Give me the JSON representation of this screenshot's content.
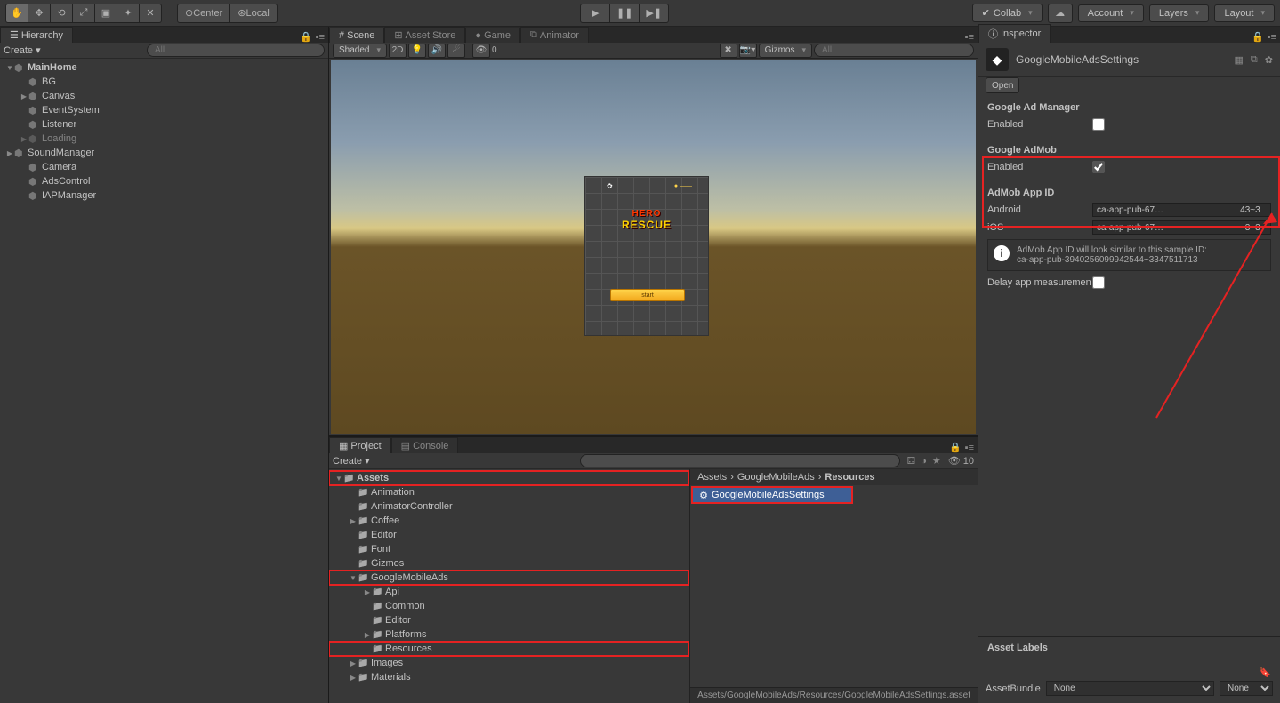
{
  "toolbar": {
    "center_label": "Center",
    "local_label": "Local",
    "collab_label": "Collab",
    "account_label": "Account",
    "layers_label": "Layers",
    "layout_label": "Layout"
  },
  "hierarchy": {
    "tab": "Hierarchy",
    "create_label": "Create",
    "search_placeholder": "All",
    "items": [
      {
        "label": "MainHome",
        "depth": 0,
        "arrow": "▼",
        "bold": true,
        "icon": "unity"
      },
      {
        "label": "BG",
        "depth": 1
      },
      {
        "label": "Canvas",
        "depth": 1,
        "arrow": "▶"
      },
      {
        "label": "EventSystem",
        "depth": 1
      },
      {
        "label": "Listener",
        "depth": 1
      },
      {
        "label": "Loading",
        "depth": 1,
        "arrow": "▶",
        "dim": true
      },
      {
        "label": "SoundManager",
        "depth": 0,
        "arrow": "▶",
        "icon": "prefab"
      },
      {
        "label": "Camera",
        "depth": 1
      },
      {
        "label": "AdsControl",
        "depth": 1
      },
      {
        "label": "IAPManager",
        "depth": 1
      }
    ]
  },
  "scene": {
    "tabs": [
      {
        "label": "Scene",
        "icon": "#"
      },
      {
        "label": "Asset Store",
        "icon": "⊞"
      },
      {
        "label": "Game",
        "icon": "●"
      },
      {
        "label": "Animator",
        "icon": "⧉"
      }
    ],
    "shade_mode": "Shaded",
    "mode_2d": "2D",
    "gizmos_label": "Gizmos",
    "search_placeholder": "All",
    "effects_count": "0",
    "game_title_top": "HERO",
    "game_title_bot": "RESCUE",
    "start_label": "start"
  },
  "project": {
    "tab": "Project",
    "console_tab": "Console",
    "create_label": "Create",
    "search_placeholder": "",
    "badge_count": "10",
    "folders": [
      {
        "label": "Assets",
        "depth": 0,
        "arrow": "▼",
        "bold": true,
        "hl": true,
        "icon": "db"
      },
      {
        "label": "Animation",
        "depth": 1
      },
      {
        "label": "AnimatorController",
        "depth": 1
      },
      {
        "label": "Coffee",
        "depth": 1,
        "arrow": "▶"
      },
      {
        "label": "Editor",
        "depth": 1
      },
      {
        "label": "Font",
        "depth": 1
      },
      {
        "label": "Gizmos",
        "depth": 1
      },
      {
        "label": "GoogleMobileAds",
        "depth": 1,
        "arrow": "▼",
        "hl": true
      },
      {
        "label": "Api",
        "depth": 2,
        "arrow": "▶"
      },
      {
        "label": "Common",
        "depth": 2
      },
      {
        "label": "Editor",
        "depth": 2
      },
      {
        "label": "Platforms",
        "depth": 2,
        "arrow": "▶"
      },
      {
        "label": "Resources",
        "depth": 2,
        "hl": true
      },
      {
        "label": "Images",
        "depth": 1,
        "arrow": "▶"
      },
      {
        "label": "Materials",
        "depth": 1,
        "arrow": "▶"
      }
    ],
    "breadcrumb": [
      "Assets",
      "GoogleMobileAds",
      "Resources"
    ],
    "asset_selected": "GoogleMobileAdsSettings",
    "status_path": "Assets/GoogleMobileAds/Resources/GoogleMobileAdsSettings.asset"
  },
  "inspector": {
    "tab": "Inspector",
    "title": "GoogleMobileAdsSettings",
    "open_label": "Open",
    "ad_manager_header": "Google Ad Manager",
    "enabled_label": "Enabled",
    "ad_manager_enabled": false,
    "admob_header": "Google AdMob",
    "admob_enabled": true,
    "admob_id_header": "AdMob App ID",
    "android_label": "Android",
    "android_value": "ca-app-pub-67…                               43~3",
    "ios_label": "iOS",
    "ios_value": "ca-app-pub-67…                                 3~3",
    "hint_line1": "AdMob App ID will look similar to this sample ID:",
    "hint_line2": "ca-app-pub-3940256099942544~3347511713",
    "delay_label": "Delay app measuremen",
    "labels_header": "Asset Labels",
    "bundle_label": "AssetBundle",
    "bundle_value": "None",
    "bundle_variant": "None"
  }
}
